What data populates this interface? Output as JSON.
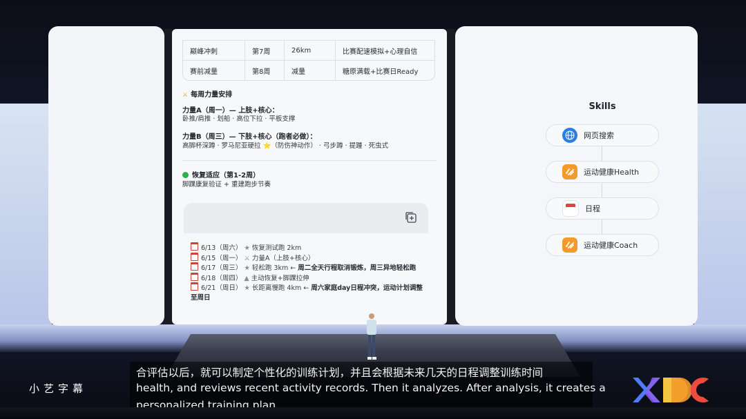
{
  "table": {
    "rows": [
      {
        "phase": "巅峰冲刺",
        "week": "第7周",
        "distance": "26km",
        "focus": "比赛配速模拟+心理自信"
      },
      {
        "phase": "赛前减量",
        "week": "第8周",
        "distance": "减量",
        "focus": "糖原满载+比赛日Ready"
      }
    ]
  },
  "strength": {
    "title": "每周力量安排",
    "a_title": "力量A（周一）— 上肢+核心：",
    "a_body": "卧推/肩推 · 划船 · 高位下拉 · 平板支撑",
    "b_title": "力量B（周三）— 下肢+核心（跑者必做）：",
    "b_body": "高脚杯深蹲 · 罗马尼亚硬拉 ⭐（防伤神动作） · 弓步蹲 · 提踵 · 死虫式"
  },
  "recovery": {
    "title": "恢复适应（第1-2周）",
    "body": "脚踝康复验证 + 重建跑步节奏"
  },
  "schedule": [
    {
      "date": "6/13（周六）",
      "text": "恢复测试跑 2km",
      "note": ""
    },
    {
      "date": "6/15（周一）",
      "text": "力量A（上肢+核心）",
      "note": ""
    },
    {
      "date": "6/17（周三）",
      "text": "轻松跑 3km ←",
      "note": "周二全天行程取消锻炼，周三异地轻松跑"
    },
    {
      "date": "6/18（周四）",
      "text": "主动恢复+脚踝拉伸",
      "note": ""
    },
    {
      "date": "6/21（周日）",
      "text": "长距离慢跑 4km ←",
      "note": "周六家庭day日程冲突，运动计划调整"
    }
  ],
  "schedule_tail": "至周日",
  "skills": {
    "title": "Skills",
    "items": [
      {
        "label": "网页搜索",
        "icon": "globe-icon",
        "color": "#2a7de1"
      },
      {
        "label": "运动健康Health",
        "icon": "health-icon",
        "color": "#f39a2b"
      },
      {
        "label": "日程",
        "icon": "calendar-icon",
        "color": "#e0463c"
      },
      {
        "label": "运动健康Coach",
        "icon": "coach-icon",
        "color": "#f39a2b"
      }
    ]
  },
  "subtitles": {
    "brand": "小艺字幕",
    "line1": "合评估以后，就可以制定个性化的训练计划，并且会根据未来几天的日程调整训练时间",
    "line2": "health, and reviews recent activity records. Then it analyzes. After analysis, it creates a",
    "line3": "personalized training plan,"
  }
}
